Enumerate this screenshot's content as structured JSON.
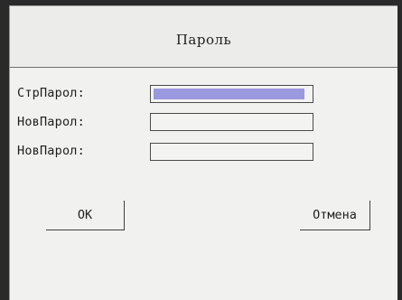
{
  "dialog": {
    "title": "Пароль"
  },
  "fields": [
    {
      "label": "СтрПарол:",
      "value": "",
      "focused": true
    },
    {
      "label": "НовПарол:",
      "value": "",
      "focused": false
    },
    {
      "label": "НовПарол:",
      "value": "",
      "focused": false
    }
  ],
  "buttons": {
    "ok_label": "OK",
    "cancel_label": "Отмена"
  },
  "colors": {
    "background": "#f1f1ef",
    "selection": "#9a98de",
    "text": "#1e1e1e"
  }
}
